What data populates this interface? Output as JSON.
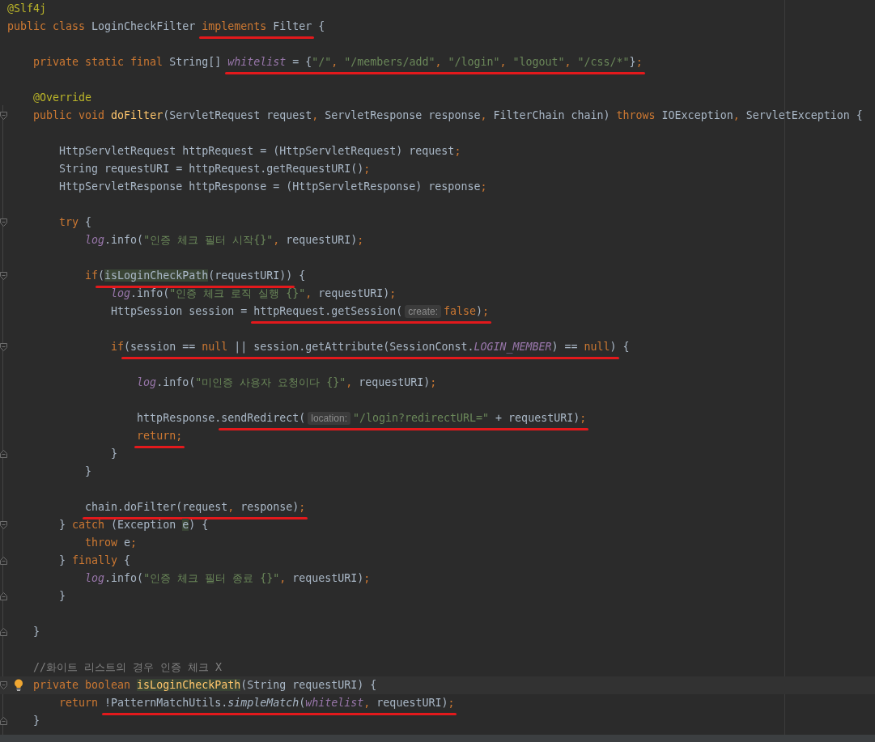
{
  "editor": {
    "lines": [
      {
        "kind": "code",
        "segments": [
          {
            "underlined": false,
            "tokens": [
              {
                "text": "@Slf4j",
                "kind": "annotation"
              }
            ]
          }
        ]
      },
      {
        "kind": "code",
        "segments": [
          {
            "underlined": false,
            "tokens": [
              {
                "text": "public class",
                "kind": "keyword"
              },
              {
                "text": " LoginCheckFilter ",
                "kind": "plain"
              }
            ]
          },
          {
            "underlined": true,
            "tokens": [
              {
                "text": "implements",
                "kind": "keyword"
              },
              {
                "text": " Filter",
                "kind": "plain"
              }
            ]
          },
          {
            "underlined": false,
            "tokens": [
              {
                "text": " {",
                "kind": "plain"
              }
            ]
          }
        ]
      },
      {
        "kind": "blank"
      },
      {
        "kind": "code",
        "segments": [
          {
            "underlined": false,
            "tokens": [
              {
                "text": "    private static final",
                "kind": "keyword"
              },
              {
                "text": " String[] ",
                "kind": "plain"
              }
            ]
          },
          {
            "underlined": true,
            "tokens": [
              {
                "text": "whitelist",
                "kind": "field"
              },
              {
                "text": " = {",
                "kind": "plain"
              },
              {
                "text": "\"/\"",
                "kind": "string"
              },
              {
                "text": ", ",
                "kind": "keyword"
              },
              {
                "text": "\"/members/add\"",
                "kind": "string"
              },
              {
                "text": ", ",
                "kind": "keyword"
              },
              {
                "text": "\"/login\"",
                "kind": "string"
              },
              {
                "text": ", ",
                "kind": "keyword"
              },
              {
                "text": "\"logout\"",
                "kind": "string"
              },
              {
                "text": ", ",
                "kind": "keyword"
              },
              {
                "text": "\"/css/*\"",
                "kind": "string"
              },
              {
                "text": "}",
                "kind": "plain"
              },
              {
                "text": ";",
                "kind": "keyword"
              }
            ]
          }
        ]
      },
      {
        "kind": "blank"
      },
      {
        "kind": "code",
        "segments": [
          {
            "underlined": false,
            "tokens": [
              {
                "text": "    @Override",
                "kind": "annotation"
              }
            ]
          }
        ]
      },
      {
        "kind": "code",
        "fold_start": true,
        "segments": [
          {
            "underlined": false,
            "tokens": [
              {
                "text": "    public void ",
                "kind": "keyword"
              },
              {
                "text": "doFilter",
                "kind": "method_declaration"
              },
              {
                "text": "(ServletRequest request",
                "kind": "plain"
              },
              {
                "text": ", ",
                "kind": "keyword"
              },
              {
                "text": "ServletResponse response",
                "kind": "plain"
              },
              {
                "text": ", ",
                "kind": "keyword"
              },
              {
                "text": "FilterChain chain) ",
                "kind": "plain"
              },
              {
                "text": "throws",
                "kind": "keyword"
              },
              {
                "text": " IOException",
                "kind": "plain"
              },
              {
                "text": ", ",
                "kind": "keyword"
              },
              {
                "text": "ServletException {",
                "kind": "plain"
              }
            ]
          }
        ]
      },
      {
        "kind": "blank"
      },
      {
        "kind": "code",
        "segments": [
          {
            "underlined": false,
            "tokens": [
              {
                "text": "        HttpServletRequest httpRequest = (HttpServletRequest) request",
                "kind": "plain"
              },
              {
                "text": ";",
                "kind": "keyword"
              }
            ]
          }
        ]
      },
      {
        "kind": "code",
        "segments": [
          {
            "underlined": false,
            "tokens": [
              {
                "text": "        String requestURI = httpRequest.getRequestURI()",
                "kind": "plain"
              },
              {
                "text": ";",
                "kind": "keyword"
              }
            ]
          }
        ]
      },
      {
        "kind": "code",
        "segments": [
          {
            "underlined": false,
            "tokens": [
              {
                "text": "        HttpServletResponse httpResponse = (HttpServletResponse) response",
                "kind": "plain"
              },
              {
                "text": ";",
                "kind": "keyword"
              }
            ]
          }
        ]
      },
      {
        "kind": "blank"
      },
      {
        "kind": "code",
        "fold_start": true,
        "segments": [
          {
            "underlined": false,
            "tokens": [
              {
                "text": "        try",
                "kind": "keyword"
              },
              {
                "text": " {",
                "kind": "plain"
              }
            ]
          }
        ]
      },
      {
        "kind": "code",
        "segments": [
          {
            "underlined": false,
            "tokens": [
              {
                "text": "            log",
                "kind": "field"
              },
              {
                "text": ".info(",
                "kind": "plain"
              },
              {
                "text": "\"인증 체크 필터 시작{}\"",
                "kind": "string"
              },
              {
                "text": ", ",
                "kind": "keyword"
              },
              {
                "text": "requestURI)",
                "kind": "plain"
              },
              {
                "text": ";",
                "kind": "keyword"
              }
            ]
          }
        ]
      },
      {
        "kind": "blank"
      },
      {
        "kind": "code",
        "fold_start": true,
        "segments": [
          {
            "underlined": false,
            "tokens": [
              {
                "text": "            if",
                "kind": "keyword"
              }
            ]
          },
          {
            "underlined": true,
            "tokens": [
              {
                "text": "(",
                "kind": "plain"
              },
              {
                "text": "isLoginCheckPath",
                "kind": "plain",
                "highlighted": true
              },
              {
                "text": "(requestURI))",
                "kind": "plain"
              }
            ]
          },
          {
            "underlined": false,
            "tokens": [
              {
                "text": " {",
                "kind": "plain"
              }
            ]
          }
        ]
      },
      {
        "kind": "code",
        "segments": [
          {
            "underlined": false,
            "tokens": [
              {
                "text": "                log",
                "kind": "field"
              },
              {
                "text": ".info(",
                "kind": "plain"
              },
              {
                "text": "\"인증 체크 로직 실행 {}\"",
                "kind": "string"
              },
              {
                "text": ", ",
                "kind": "keyword"
              },
              {
                "text": "requestURI)",
                "kind": "plain"
              },
              {
                "text": ";",
                "kind": "keyword"
              }
            ]
          }
        ]
      },
      {
        "kind": "code",
        "segments": [
          {
            "underlined": false,
            "tokens": [
              {
                "text": "                HttpSession session = ",
                "kind": "plain"
              }
            ]
          },
          {
            "underlined": true,
            "tokens": [
              {
                "text": "httpRequest.getSession(",
                "kind": "plain"
              },
              {
                "text": "create:",
                "kind": "hint"
              },
              {
                "text": "false",
                "kind": "keyword"
              },
              {
                "text": ")",
                "kind": "plain"
              },
              {
                "text": ";",
                "kind": "keyword"
              }
            ]
          }
        ]
      },
      {
        "kind": "blank"
      },
      {
        "kind": "code",
        "fold_start": true,
        "segments": [
          {
            "underlined": false,
            "tokens": [
              {
                "text": "                if",
                "kind": "keyword"
              }
            ]
          },
          {
            "underlined": true,
            "tokens": [
              {
                "text": "(session == ",
                "kind": "plain"
              },
              {
                "text": "null",
                "kind": "keyword"
              },
              {
                "text": " || session.getAttribute(SessionConst.",
                "kind": "plain"
              },
              {
                "text": "LOGIN_MEMBER",
                "kind": "field"
              },
              {
                "text": ") == ",
                "kind": "plain"
              },
              {
                "text": "null",
                "kind": "keyword"
              },
              {
                "text": ")",
                "kind": "plain"
              }
            ]
          },
          {
            "underlined": false,
            "tokens": [
              {
                "text": " {",
                "kind": "plain"
              }
            ]
          }
        ]
      },
      {
        "kind": "blank"
      },
      {
        "kind": "code",
        "segments": [
          {
            "underlined": false,
            "tokens": [
              {
                "text": "                    log",
                "kind": "field"
              },
              {
                "text": ".info(",
                "kind": "plain"
              },
              {
                "text": "\"미인증 사용자 요청이다 {}\"",
                "kind": "string"
              },
              {
                "text": ", ",
                "kind": "keyword"
              },
              {
                "text": "requestURI)",
                "kind": "plain"
              },
              {
                "text": ";",
                "kind": "keyword"
              }
            ]
          }
        ]
      },
      {
        "kind": "blank"
      },
      {
        "kind": "code",
        "segments": [
          {
            "underlined": false,
            "tokens": [
              {
                "text": "                    httpResponse.",
                "kind": "plain"
              }
            ]
          },
          {
            "underlined": true,
            "tokens": [
              {
                "text": "sendRedirect(",
                "kind": "plain"
              },
              {
                "text": "location:",
                "kind": "hint"
              },
              {
                "text": "\"/login?redirectURL=\"",
                "kind": "string"
              },
              {
                "text": " + requestURI)",
                "kind": "plain"
              },
              {
                "text": ";",
                "kind": "keyword"
              }
            ]
          }
        ]
      },
      {
        "kind": "code",
        "segments": [
          {
            "underlined": true,
            "tokens": [
              {
                "text": "                    return",
                "kind": "keyword"
              },
              {
                "text": ";",
                "kind": "keyword"
              }
            ]
          }
        ]
      },
      {
        "kind": "code",
        "fold_end": true,
        "segments": [
          {
            "underlined": false,
            "tokens": [
              {
                "text": "                }",
                "kind": "plain"
              }
            ]
          }
        ]
      },
      {
        "kind": "code",
        "segments": [
          {
            "underlined": false,
            "tokens": [
              {
                "text": "            }",
                "kind": "plain"
              }
            ]
          }
        ]
      },
      {
        "kind": "blank"
      },
      {
        "kind": "code",
        "segments": [
          {
            "underlined": true,
            "tokens": [
              {
                "text": "            chain.doFilter(request",
                "kind": "plain"
              },
              {
                "text": ", ",
                "kind": "keyword"
              },
              {
                "text": "response)",
                "kind": "plain"
              },
              {
                "text": ";",
                "kind": "keyword"
              }
            ]
          }
        ]
      },
      {
        "kind": "code",
        "fold_start": true,
        "segments": [
          {
            "underlined": false,
            "tokens": [
              {
                "text": "        } ",
                "kind": "plain"
              },
              {
                "text": "catch",
                "kind": "keyword"
              },
              {
                "text": " (Exception ",
                "kind": "plain"
              },
              {
                "text": "e",
                "kind": "plain",
                "highlighted": true
              },
              {
                "text": ") {",
                "kind": "plain"
              }
            ]
          }
        ]
      },
      {
        "kind": "code",
        "segments": [
          {
            "underlined": false,
            "tokens": [
              {
                "text": "            throw",
                "kind": "keyword"
              },
              {
                "text": " e",
                "kind": "plain"
              },
              {
                "text": ";",
                "kind": "keyword"
              }
            ]
          }
        ]
      },
      {
        "kind": "code",
        "fold_end": true,
        "segments": [
          {
            "underlined": false,
            "tokens": [
              {
                "text": "        } ",
                "kind": "plain"
              },
              {
                "text": "finally",
                "kind": "keyword"
              },
              {
                "text": " {",
                "kind": "plain"
              }
            ]
          }
        ]
      },
      {
        "kind": "code",
        "segments": [
          {
            "underlined": false,
            "tokens": [
              {
                "text": "            log",
                "kind": "field"
              },
              {
                "text": ".info(",
                "kind": "plain"
              },
              {
                "text": "\"인증 체크 필터 종료 {}\"",
                "kind": "string"
              },
              {
                "text": ", ",
                "kind": "keyword"
              },
              {
                "text": "requestURI)",
                "kind": "plain"
              },
              {
                "text": ";",
                "kind": "keyword"
              }
            ]
          }
        ]
      },
      {
        "kind": "code",
        "fold_end": true,
        "segments": [
          {
            "underlined": false,
            "tokens": [
              {
                "text": "        }",
                "kind": "plain"
              }
            ]
          }
        ]
      },
      {
        "kind": "blank"
      },
      {
        "kind": "code",
        "fold_end": true,
        "segments": [
          {
            "underlined": false,
            "tokens": [
              {
                "text": "    }",
                "kind": "plain"
              }
            ]
          }
        ]
      },
      {
        "kind": "blank"
      },
      {
        "kind": "code",
        "segments": [
          {
            "underlined": false,
            "tokens": [
              {
                "text": "    //화이트 리스트의 경우 인증 체크 X",
                "kind": "comment"
              }
            ]
          }
        ]
      },
      {
        "kind": "code",
        "fold_start": true,
        "current": true,
        "intention_bulb": true,
        "segments": [
          {
            "underlined": false,
            "tokens": [
              {
                "text": "    private boolean ",
                "kind": "keyword"
              },
              {
                "text": "isLoginCheckPath",
                "kind": "method_declaration",
                "highlighted": true
              },
              {
                "text": "(String requestURI) {",
                "kind": "plain"
              }
            ]
          }
        ]
      },
      {
        "kind": "code",
        "segments": [
          {
            "underlined": false,
            "tokens": [
              {
                "text": "        return ",
                "kind": "keyword"
              }
            ]
          },
          {
            "underlined": true,
            "tokens": [
              {
                "text": "!PatternMatchUtils.",
                "kind": "plain"
              },
              {
                "text": "simpleMatch",
                "kind": "static_call"
              },
              {
                "text": "(",
                "kind": "plain"
              },
              {
                "text": "whitelist",
                "kind": "field"
              },
              {
                "text": ", ",
                "kind": "keyword"
              },
              {
                "text": "requestURI)",
                "kind": "plain"
              },
              {
                "text": ";",
                "kind": "keyword"
              }
            ]
          }
        ]
      },
      {
        "kind": "code",
        "fold_end": true,
        "segments": [
          {
            "underlined": false,
            "tokens": [
              {
                "text": "    }",
                "kind": "plain"
              }
            ]
          }
        ]
      }
    ]
  }
}
